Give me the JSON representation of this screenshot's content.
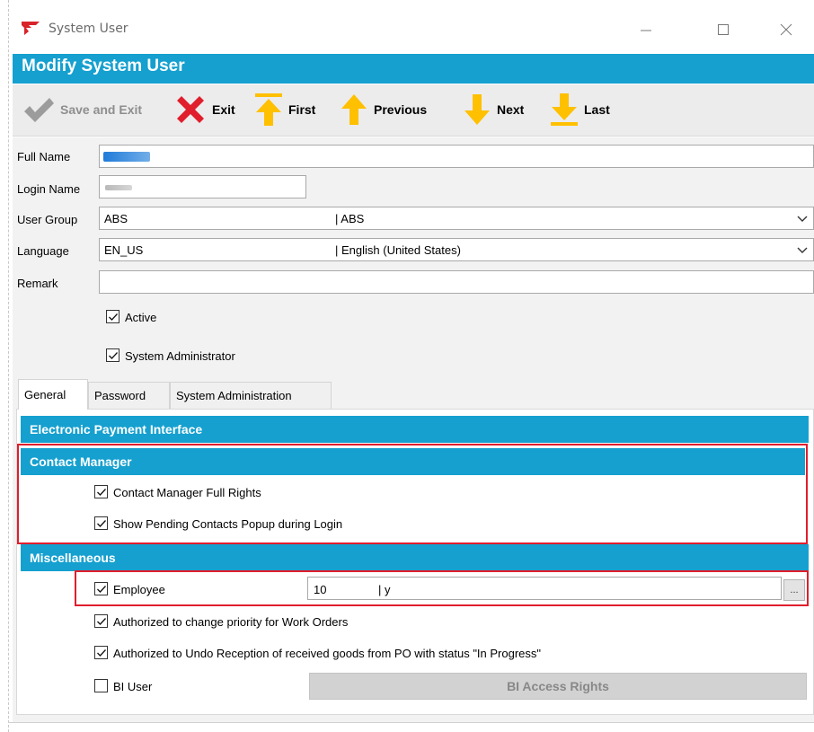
{
  "window": {
    "title": "System User",
    "minimize_icon": "minimize-icon",
    "maximize_icon": "maximize-icon",
    "close_icon": "close-icon"
  },
  "header": {
    "title": "Modify System User"
  },
  "toolbar": {
    "save_exit": "Save and Exit",
    "exit": "Exit",
    "first": "First",
    "previous": "Previous",
    "next": "Next",
    "last": "Last"
  },
  "form": {
    "full_name_label": "Full Name",
    "login_name_label": "Login Name",
    "user_group_label": "User Group",
    "user_group_code": "ABS",
    "user_group_desc": "| ABS",
    "language_label": "Language",
    "language_code": "EN_US",
    "language_desc": "| English (United States)",
    "remark_label": "Remark",
    "remark_value": "",
    "active_label": "Active",
    "active_checked": true,
    "sysadmin_label": "System Administrator",
    "sysadmin_checked": true
  },
  "tabs": [
    {
      "label": "General",
      "active": true
    },
    {
      "label": "Password",
      "active": false
    },
    {
      "label": "System Administration",
      "active": false
    }
  ],
  "sections": {
    "epi": "Electronic Payment Interface",
    "contact_manager": "Contact Manager",
    "miscellaneous": "Miscellaneous"
  },
  "contact_manager": {
    "full_rights_label": "Contact Manager Full Rights",
    "pending_popup_label": "Show Pending Contacts Popup during Login"
  },
  "misc": {
    "employee_label": "Employee",
    "employee_code": "10",
    "employee_desc": "| y",
    "ellipsis": "...",
    "wo_priority_label": "Authorized to change priority for Work Orders",
    "undo_reception_label": "Authorized to Undo Reception of received goods from PO with status \"In Progress\"",
    "bi_user_label": "BI User",
    "bi_access_button": "BI Access Rights"
  },
  "colors": {
    "accent": "#15a0cf",
    "highlight_border": "#e01e2c",
    "arrow": "#ffc000",
    "exit_x": "#e01e2c"
  }
}
